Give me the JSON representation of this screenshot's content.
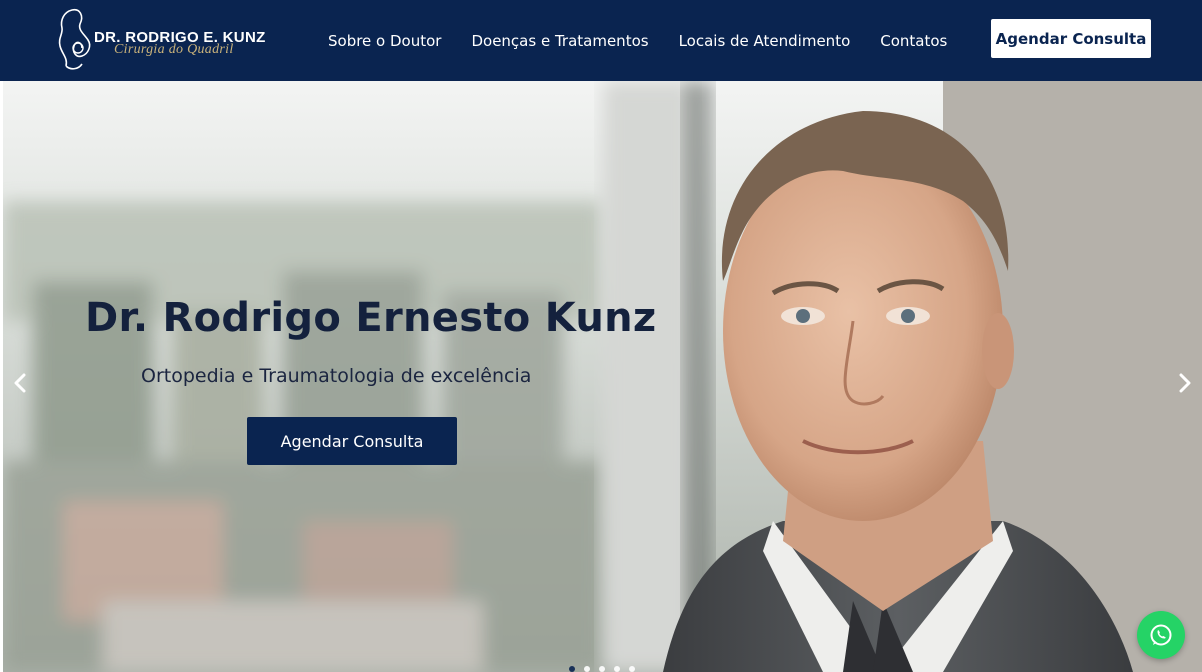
{
  "brand": {
    "name": "DR. RODRIGO E. KUNZ",
    "tagline": "Cirurgia do Quadril",
    "colors": {
      "primary": "#0a2450",
      "accent": "#c9b27a",
      "whatsapp": "#25d366"
    }
  },
  "nav": {
    "items": [
      {
        "label": "Sobre o Doutor"
      },
      {
        "label": "Doenças e Tratamentos"
      },
      {
        "label": "Locais de Atendimento"
      },
      {
        "label": "Contatos"
      }
    ],
    "cta_label": "Agendar Consulta"
  },
  "hero": {
    "title": "Dr. Rodrigo Ernesto Kunz",
    "subtitle": "Ortopedia e Traumatologia de excelência",
    "cta_label": "Agendar Consulta",
    "prev_icon": "chevron-left-icon",
    "next_icon": "chevron-right-icon",
    "slides_count": 5,
    "active_slide": 1
  },
  "floating": {
    "icon": "whatsapp-icon"
  }
}
